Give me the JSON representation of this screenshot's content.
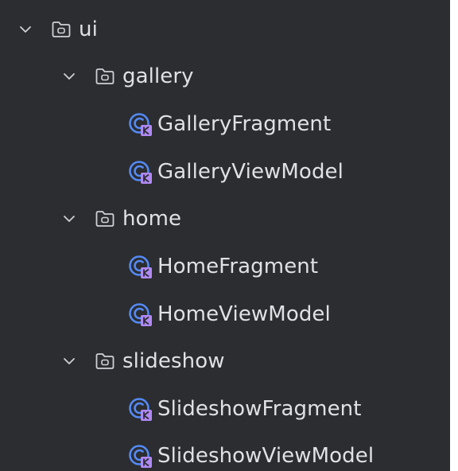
{
  "tree": {
    "root": {
      "label": "ui",
      "expanded": true,
      "icon": "folder-icon"
    },
    "packages": [
      {
        "label": "gallery",
        "expanded": true,
        "icon": "folder-icon",
        "classes": [
          {
            "label": "GalleryFragment",
            "icon": "kotlin-class-icon"
          },
          {
            "label": "GalleryViewModel",
            "icon": "kotlin-class-icon"
          }
        ]
      },
      {
        "label": "home",
        "expanded": true,
        "icon": "folder-icon",
        "classes": [
          {
            "label": "HomeFragment",
            "icon": "kotlin-class-icon"
          },
          {
            "label": "HomeViewModel",
            "icon": "kotlin-class-icon"
          }
        ]
      },
      {
        "label": "slideshow",
        "expanded": true,
        "icon": "folder-icon",
        "classes": [
          {
            "label": "SlideshowFragment",
            "icon": "kotlin-class-icon"
          },
          {
            "label": "SlideshowViewModel",
            "icon": "kotlin-class-icon"
          }
        ]
      }
    ]
  },
  "colors": {
    "background": "#2b2d30",
    "text": "#dfe1e5",
    "icon_stroke": "#ced0d6",
    "class_icon_blue": "#548af7",
    "kotlin_badge": "#b189f5"
  }
}
